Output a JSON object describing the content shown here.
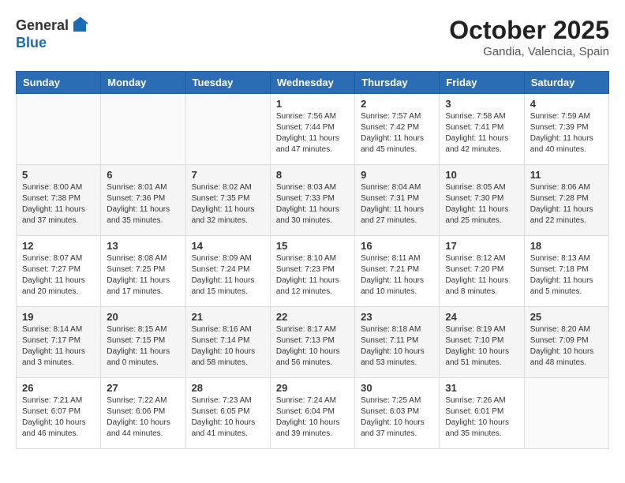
{
  "logo": {
    "general": "General",
    "blue": "Blue"
  },
  "header": {
    "month": "October 2025",
    "location": "Gandia, Valencia, Spain"
  },
  "weekdays": [
    "Sunday",
    "Monday",
    "Tuesday",
    "Wednesday",
    "Thursday",
    "Friday",
    "Saturday"
  ],
  "weeks": [
    [
      {
        "day": "",
        "info": ""
      },
      {
        "day": "",
        "info": ""
      },
      {
        "day": "",
        "info": ""
      },
      {
        "day": "1",
        "info": "Sunrise: 7:56 AM\nSunset: 7:44 PM\nDaylight: 11 hours\nand 47 minutes."
      },
      {
        "day": "2",
        "info": "Sunrise: 7:57 AM\nSunset: 7:42 PM\nDaylight: 11 hours\nand 45 minutes."
      },
      {
        "day": "3",
        "info": "Sunrise: 7:58 AM\nSunset: 7:41 PM\nDaylight: 11 hours\nand 42 minutes."
      },
      {
        "day": "4",
        "info": "Sunrise: 7:59 AM\nSunset: 7:39 PM\nDaylight: 11 hours\nand 40 minutes."
      }
    ],
    [
      {
        "day": "5",
        "info": "Sunrise: 8:00 AM\nSunset: 7:38 PM\nDaylight: 11 hours\nand 37 minutes."
      },
      {
        "day": "6",
        "info": "Sunrise: 8:01 AM\nSunset: 7:36 PM\nDaylight: 11 hours\nand 35 minutes."
      },
      {
        "day": "7",
        "info": "Sunrise: 8:02 AM\nSunset: 7:35 PM\nDaylight: 11 hours\nand 32 minutes."
      },
      {
        "day": "8",
        "info": "Sunrise: 8:03 AM\nSunset: 7:33 PM\nDaylight: 11 hours\nand 30 minutes."
      },
      {
        "day": "9",
        "info": "Sunrise: 8:04 AM\nSunset: 7:31 PM\nDaylight: 11 hours\nand 27 minutes."
      },
      {
        "day": "10",
        "info": "Sunrise: 8:05 AM\nSunset: 7:30 PM\nDaylight: 11 hours\nand 25 minutes."
      },
      {
        "day": "11",
        "info": "Sunrise: 8:06 AM\nSunset: 7:28 PM\nDaylight: 11 hours\nand 22 minutes."
      }
    ],
    [
      {
        "day": "12",
        "info": "Sunrise: 8:07 AM\nSunset: 7:27 PM\nDaylight: 11 hours\nand 20 minutes."
      },
      {
        "day": "13",
        "info": "Sunrise: 8:08 AM\nSunset: 7:25 PM\nDaylight: 11 hours\nand 17 minutes."
      },
      {
        "day": "14",
        "info": "Sunrise: 8:09 AM\nSunset: 7:24 PM\nDaylight: 11 hours\nand 15 minutes."
      },
      {
        "day": "15",
        "info": "Sunrise: 8:10 AM\nSunset: 7:23 PM\nDaylight: 11 hours\nand 12 minutes."
      },
      {
        "day": "16",
        "info": "Sunrise: 8:11 AM\nSunset: 7:21 PM\nDaylight: 11 hours\nand 10 minutes."
      },
      {
        "day": "17",
        "info": "Sunrise: 8:12 AM\nSunset: 7:20 PM\nDaylight: 11 hours\nand 8 minutes."
      },
      {
        "day": "18",
        "info": "Sunrise: 8:13 AM\nSunset: 7:18 PM\nDaylight: 11 hours\nand 5 minutes."
      }
    ],
    [
      {
        "day": "19",
        "info": "Sunrise: 8:14 AM\nSunset: 7:17 PM\nDaylight: 11 hours\nand 3 minutes."
      },
      {
        "day": "20",
        "info": "Sunrise: 8:15 AM\nSunset: 7:15 PM\nDaylight: 11 hours\nand 0 minutes."
      },
      {
        "day": "21",
        "info": "Sunrise: 8:16 AM\nSunset: 7:14 PM\nDaylight: 10 hours\nand 58 minutes."
      },
      {
        "day": "22",
        "info": "Sunrise: 8:17 AM\nSunset: 7:13 PM\nDaylight: 10 hours\nand 56 minutes."
      },
      {
        "day": "23",
        "info": "Sunrise: 8:18 AM\nSunset: 7:11 PM\nDaylight: 10 hours\nand 53 minutes."
      },
      {
        "day": "24",
        "info": "Sunrise: 8:19 AM\nSunset: 7:10 PM\nDaylight: 10 hours\nand 51 minutes."
      },
      {
        "day": "25",
        "info": "Sunrise: 8:20 AM\nSunset: 7:09 PM\nDaylight: 10 hours\nand 48 minutes."
      }
    ],
    [
      {
        "day": "26",
        "info": "Sunrise: 7:21 AM\nSunset: 6:07 PM\nDaylight: 10 hours\nand 46 minutes."
      },
      {
        "day": "27",
        "info": "Sunrise: 7:22 AM\nSunset: 6:06 PM\nDaylight: 10 hours\nand 44 minutes."
      },
      {
        "day": "28",
        "info": "Sunrise: 7:23 AM\nSunset: 6:05 PM\nDaylight: 10 hours\nand 41 minutes."
      },
      {
        "day": "29",
        "info": "Sunrise: 7:24 AM\nSunset: 6:04 PM\nDaylight: 10 hours\nand 39 minutes."
      },
      {
        "day": "30",
        "info": "Sunrise: 7:25 AM\nSunset: 6:03 PM\nDaylight: 10 hours\nand 37 minutes."
      },
      {
        "day": "31",
        "info": "Sunrise: 7:26 AM\nSunset: 6:01 PM\nDaylight: 10 hours\nand 35 minutes."
      },
      {
        "day": "",
        "info": ""
      }
    ]
  ]
}
